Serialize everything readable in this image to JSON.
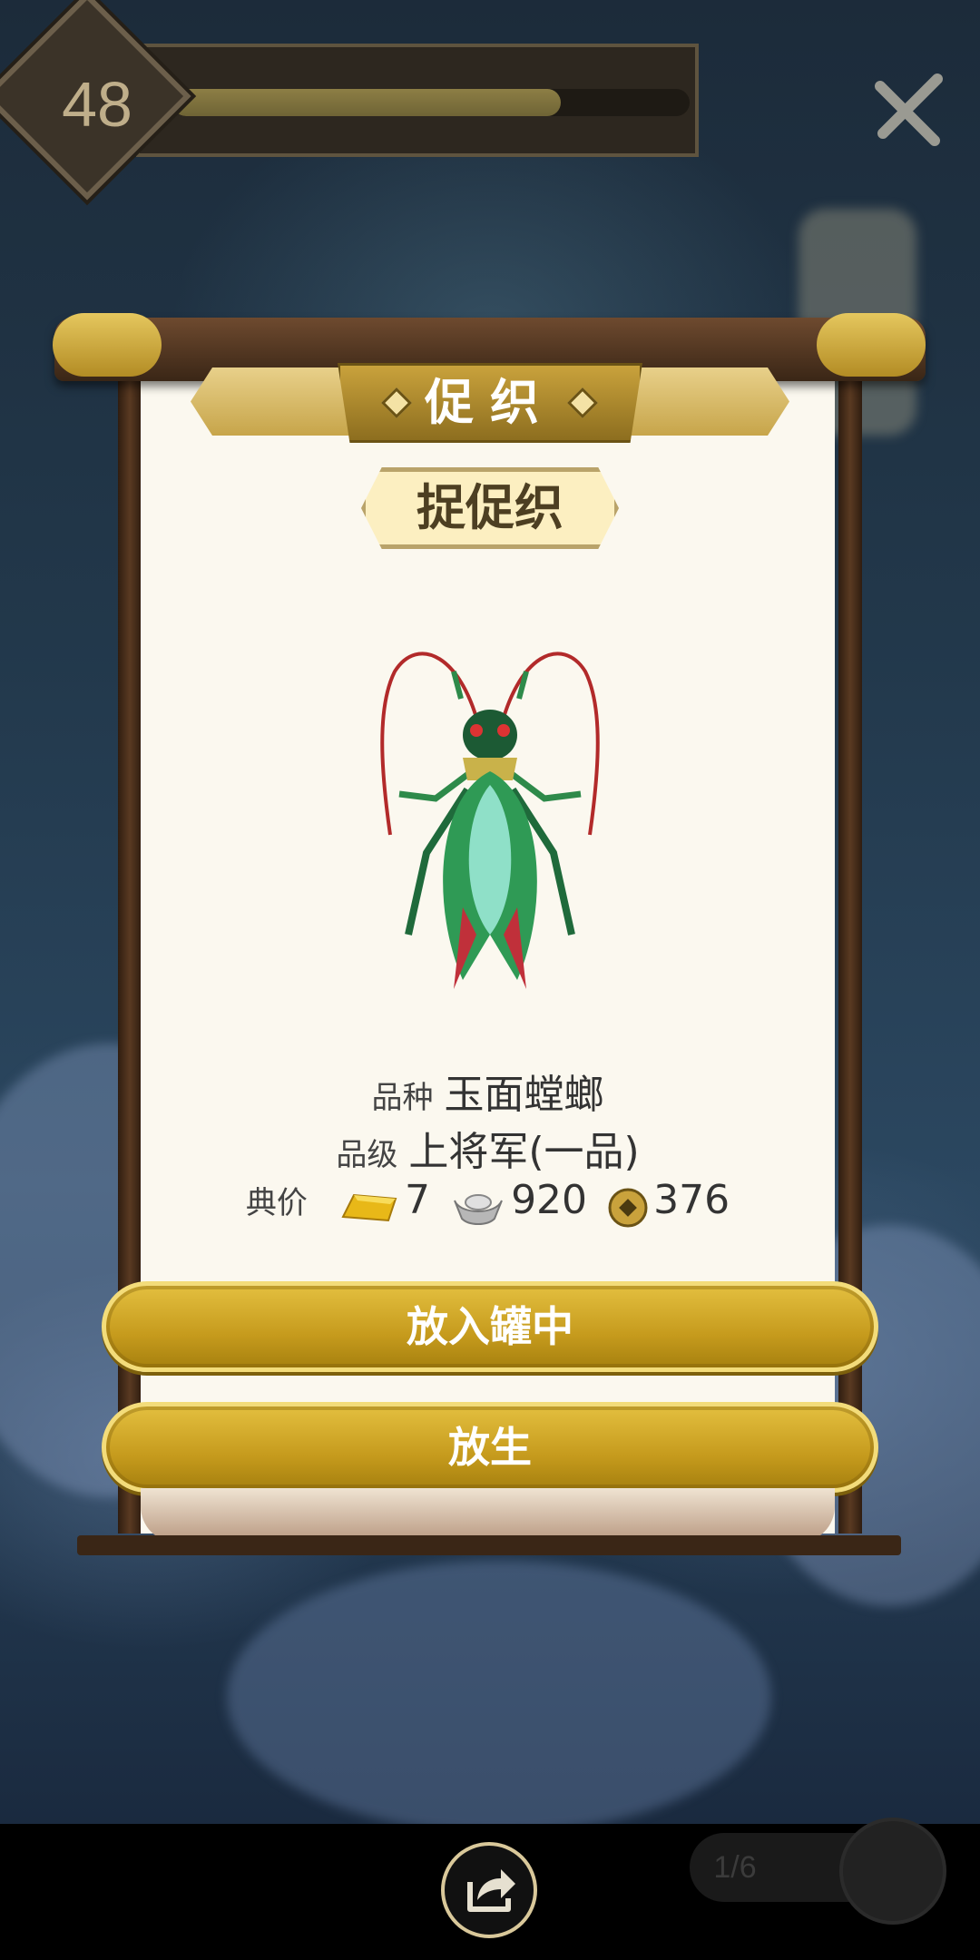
{
  "level": {
    "number": "48",
    "progress": 0.75
  },
  "banner": {
    "title": "促织"
  },
  "creature": {
    "name_plate": "捉促织"
  },
  "info": {
    "breed_label": "品种",
    "breed_value": "玉面螳螂",
    "grade_label": "品级",
    "grade_value": "上将军(一品)",
    "price_label": "典价",
    "gold": "7",
    "silver": "920",
    "copper": "376"
  },
  "buttons": {
    "put_in_jar": "放入罐中",
    "release": "放生"
  },
  "pager": {
    "text": "1/6"
  },
  "colors": {
    "gold": "#c69b1d",
    "paper": "#fbf8ef",
    "wood": "#3a2616"
  }
}
